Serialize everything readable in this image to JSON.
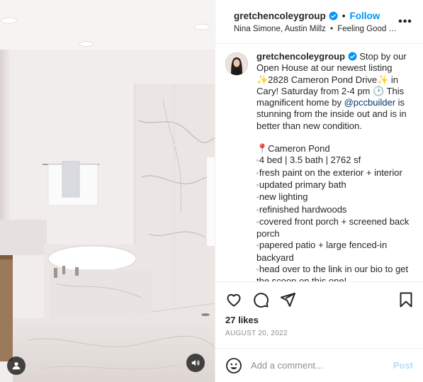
{
  "header": {
    "username": "gretchencoleygroup",
    "separator": "•",
    "follow_label": "Follow",
    "audio": "Nina Simone, Austin Millz",
    "audio_sep": "•",
    "audio_track": "Feeling Good (A...",
    "more_label": "•••"
  },
  "caption": {
    "username": "gretchencoleygroup",
    "intro": "Stop by our Open House at our newest listing ✨2828 Cameron Pond Drive✨ in Cary! Saturday from 2-4 pm 🕑 This magnificent home by",
    "mention": "@pccbuilder",
    "intro_end": "is stunning from the inside out and is in better than new condition.",
    "place": "📍Cameron Pond",
    "bullet": "▫",
    "lines": [
      "4 bed | 3.5 bath | 2762 sf",
      "fresh paint on the exterior + interior",
      "updated primary bath",
      "new lighting",
      "refinished hardwoods",
      "covered front porch + screened back porch",
      "papered patio + large fenced-in backyard",
      "head over to the link in our bio to get the scoop on this one!"
    ]
  },
  "stats": {
    "likes": "27 likes",
    "date": "AUGUST 20, 2022"
  },
  "comment": {
    "placeholder": "Add a comment...",
    "post_label": "Post"
  },
  "colors": {
    "link_blue": "#0095f6",
    "mention_blue": "#00376b",
    "post_disabled": "#b2dffc",
    "muted": "#8e8e8e"
  },
  "icons": [
    "user-tag-icon",
    "sound-icon",
    "verified-icon",
    "more-icon",
    "heart-icon",
    "comment-icon",
    "share-icon",
    "save-icon",
    "emoji-icon"
  ]
}
